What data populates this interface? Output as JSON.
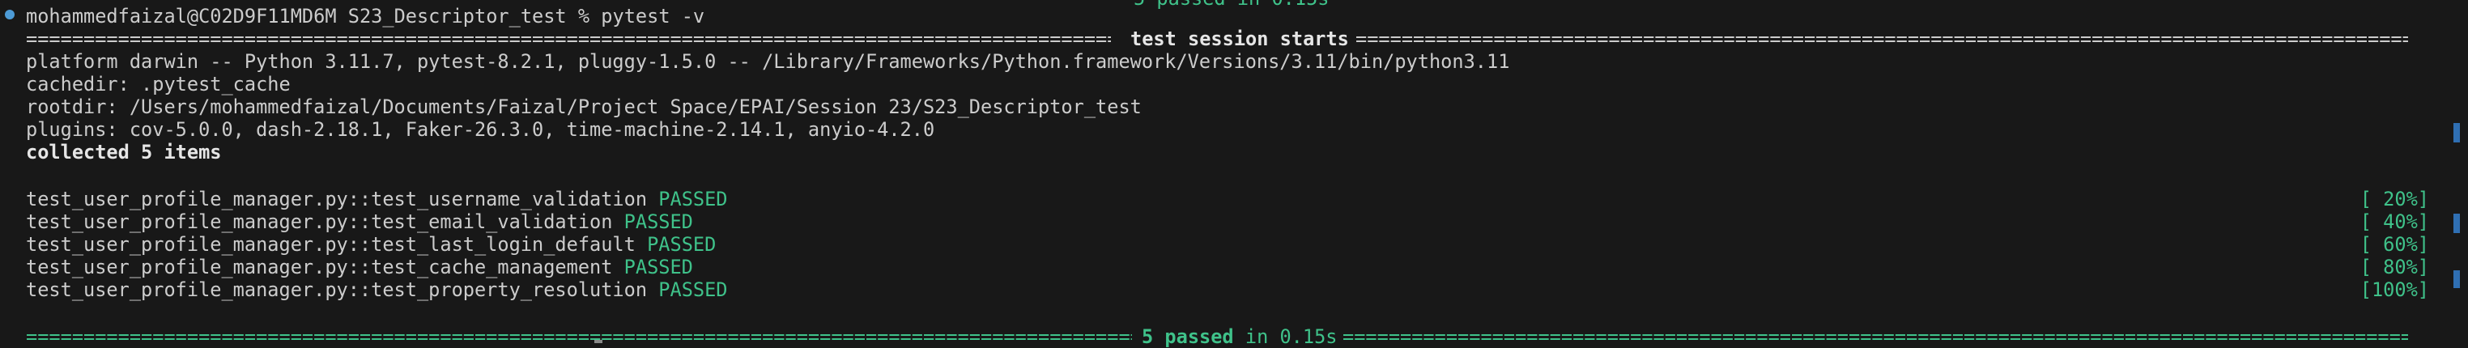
{
  "top_partial_text": "5 passed in 0.15s",
  "prompt": {
    "user_host": "mohammedfaizal@C02D9F11MD6M",
    "cwd": "S23_Descriptor_test",
    "symbol": "%",
    "command": "pytest -v"
  },
  "session_header": {
    "title": "test session starts"
  },
  "info_lines": [
    "platform darwin -- Python 3.11.7, pytest-8.2.1, pluggy-1.5.0 -- /Library/Frameworks/Python.framework/Versions/3.11/bin/python3.11",
    "cachedir: .pytest_cache",
    "rootdir: /Users/mohammedfaizal/Documents/Faizal/Project Space/EPAI/Session 23/S23_Descriptor_test",
    "plugins: cov-5.0.0, dash-2.18.1, Faker-26.3.0, time-machine-2.14.1, anyio-4.2.0"
  ],
  "collected": "collected 5 items",
  "tests": [
    {
      "name": "test_user_profile_manager.py::test_username_validation",
      "status": "PASSED",
      "progress": "[ 20%]"
    },
    {
      "name": "test_user_profile_manager.py::test_email_validation",
      "status": "PASSED",
      "progress": "[ 40%]"
    },
    {
      "name": "test_user_profile_manager.py::test_last_login_default",
      "status": "PASSED",
      "progress": "[ 60%]"
    },
    {
      "name": "test_user_profile_manager.py::test_cache_management",
      "status": "PASSED",
      "progress": "[ 80%]"
    },
    {
      "name": "test_user_profile_manager.py::test_property_resolution",
      "status": "PASSED",
      "progress": "[100%]"
    }
  ],
  "summary": {
    "passed": "5 passed",
    "duration": "in 0.15s"
  },
  "colors": {
    "background": "#181818",
    "text": "#cccccc",
    "pass_green": "#3fc28a",
    "prompt_dot": "#4d9bd6",
    "scroll_marker": "#2f6fb3"
  }
}
